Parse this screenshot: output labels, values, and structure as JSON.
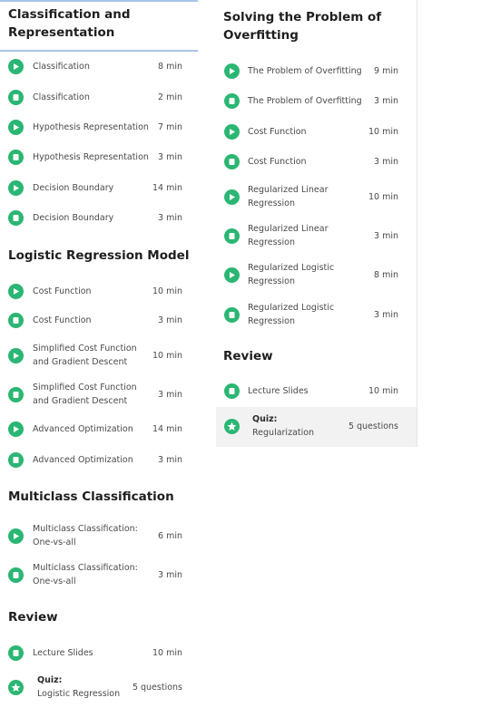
{
  "colors": {
    "accent": "#2bb673",
    "header_rule": "#a9c4e8"
  },
  "left": {
    "sections": [
      {
        "title": "Classification and Representation",
        "items": [
          {
            "icon": "play-icon",
            "label": "Classification",
            "dur": "8 min"
          },
          {
            "icon": "reading-icon",
            "label": "Classification",
            "dur": "2 min"
          },
          {
            "icon": "play-icon",
            "label": "Hypothesis Representation",
            "dur": "7 min"
          },
          {
            "icon": "reading-icon",
            "label": "Hypothesis Representation",
            "dur": "3 min"
          },
          {
            "icon": "play-icon",
            "label": "Decision Boundary",
            "dur": "14 min"
          },
          {
            "icon": "reading-icon",
            "label": "Decision Boundary",
            "dur": "3 min"
          }
        ]
      },
      {
        "title": "Logistic Regression Model",
        "items": [
          {
            "icon": "play-icon",
            "label": "Cost Function",
            "dur": "10 min"
          },
          {
            "icon": "reading-icon",
            "label": "Cost Function",
            "dur": "3 min"
          },
          {
            "icon": "play-icon",
            "label": "Simplified Cost Function and Gradient Descent",
            "dur": "10 min"
          },
          {
            "icon": "reading-icon",
            "label": "Simplified Cost Function and Gradient Descent",
            "dur": "3 min"
          },
          {
            "icon": "play-icon",
            "label": "Advanced Optimization",
            "dur": "14 min"
          },
          {
            "icon": "reading-icon",
            "label": "Advanced Optimization",
            "dur": "3 min"
          }
        ]
      },
      {
        "title": "Multiclass Classification",
        "items": [
          {
            "icon": "play-icon",
            "label": "Multiclass Classification: One-vs-all",
            "dur": "6 min"
          },
          {
            "icon": "reading-icon",
            "label": "Multiclass Classification: One-vs-all",
            "dur": "3 min"
          }
        ]
      },
      {
        "title": "Review",
        "items": [
          {
            "icon": "reading-icon",
            "label": "Lecture Slides",
            "dur": "10 min"
          },
          {
            "icon": "quiz-icon",
            "label_title": "Quiz:",
            "label": "Logistic Regression",
            "dur": "5 questions"
          }
        ]
      }
    ]
  },
  "right": {
    "sections": [
      {
        "title": "Solving the Problem of Overfitting",
        "items": [
          {
            "icon": "play-icon",
            "label": "The Problem of Overfitting",
            "dur": "9 min"
          },
          {
            "icon": "reading-icon",
            "label": "The Problem of Overfitting",
            "dur": "3 min"
          },
          {
            "icon": "play-icon",
            "label": "Cost Function",
            "dur": "10 min"
          },
          {
            "icon": "reading-icon",
            "label": "Cost Function",
            "dur": "3 min"
          },
          {
            "icon": "play-icon",
            "label": "Regularized Linear Regression",
            "dur": "10 min"
          },
          {
            "icon": "reading-icon",
            "label": "Regularized Linear Regression",
            "dur": "3 min"
          },
          {
            "icon": "play-icon",
            "label": "Regularized Logistic Regression",
            "dur": "8 min"
          },
          {
            "icon": "reading-icon",
            "label": "Regularized Logistic Regression",
            "dur": "3 min"
          }
        ]
      },
      {
        "title": "Review",
        "items": [
          {
            "icon": "reading-icon",
            "label": "Lecture Slides",
            "dur": "10 min"
          },
          {
            "icon": "quiz-icon",
            "label_title": "Quiz:",
            "label": "Regularization",
            "dur": "5 questions"
          }
        ]
      }
    ]
  }
}
